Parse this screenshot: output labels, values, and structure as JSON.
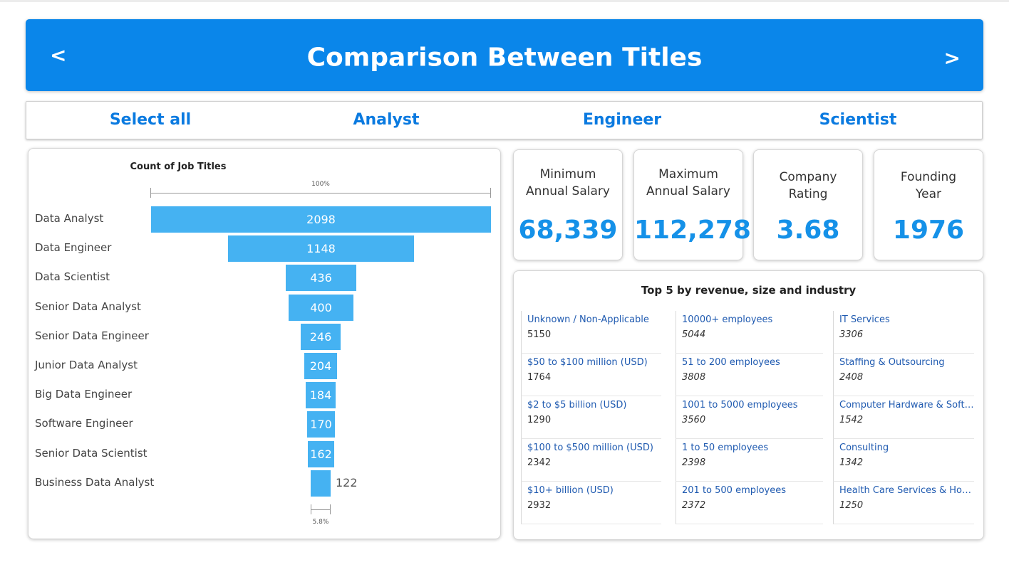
{
  "header": {
    "title": "Comparison Between Titles",
    "prev": "<",
    "next": ">"
  },
  "tabs": [
    "Select all",
    "Analyst",
    "Engineer",
    "Scientist"
  ],
  "funnel": {
    "title": "Count of Job Titles",
    "top_pct": "100%",
    "bottom_pct": "5.8%"
  },
  "chart_data": {
    "type": "bar",
    "title": "Count of Job Titles",
    "categories": [
      "Data Analyst",
      "Data Engineer",
      "Data Scientist",
      "Senior Data Analyst",
      "Senior Data Engineer",
      "Junior Data Analyst",
      "Big Data Engineer",
      "Software Engineer",
      "Senior Data Scientist",
      "Business Data Analyst"
    ],
    "values": [
      2098,
      1148,
      436,
      400,
      246,
      204,
      184,
      170,
      162,
      122
    ],
    "color": "#45b2f2"
  },
  "kpis": [
    {
      "label1": "Minimum",
      "label2": "Annual Salary",
      "value": "68,339"
    },
    {
      "label1": "Maximum",
      "label2": "Annual Salary",
      "value": "112,278"
    },
    {
      "label1": "Company",
      "label2": "Rating",
      "value": "3.68"
    },
    {
      "label1": "Founding",
      "label2": "Year",
      "value": "1976"
    }
  ],
  "top5": {
    "title": "Top 5 by revenue, size and industry",
    "revenue": [
      {
        "name": "Unknown / Non-Applicable",
        "value": "5150"
      },
      {
        "name": "$50 to $100 million (USD)",
        "value": "1764"
      },
      {
        "name": "$2 to $5 billion (USD)",
        "value": "1290"
      },
      {
        "name": "$100 to $500 million (USD)",
        "value": "2342"
      },
      {
        "name": "$10+ billion (USD)",
        "value": "2932"
      }
    ],
    "size": [
      {
        "name": "10000+ employees",
        "value": "5044"
      },
      {
        "name": "51 to 200 employees",
        "value": "3808"
      },
      {
        "name": "1001 to 5000 employees",
        "value": "3560"
      },
      {
        "name": "1 to 50 employees",
        "value": "2398"
      },
      {
        "name": "201 to 500 employees",
        "value": "2372"
      }
    ],
    "industry": [
      {
        "name": "IT Services",
        "value": "3306"
      },
      {
        "name": "Staffing & Outsourcing",
        "value": "2408"
      },
      {
        "name": "Computer Hardware & Softw...",
        "value": "1542"
      },
      {
        "name": "Consulting",
        "value": "1342"
      },
      {
        "name": "Health Care Services & Hospi...",
        "value": "1250"
      }
    ]
  }
}
